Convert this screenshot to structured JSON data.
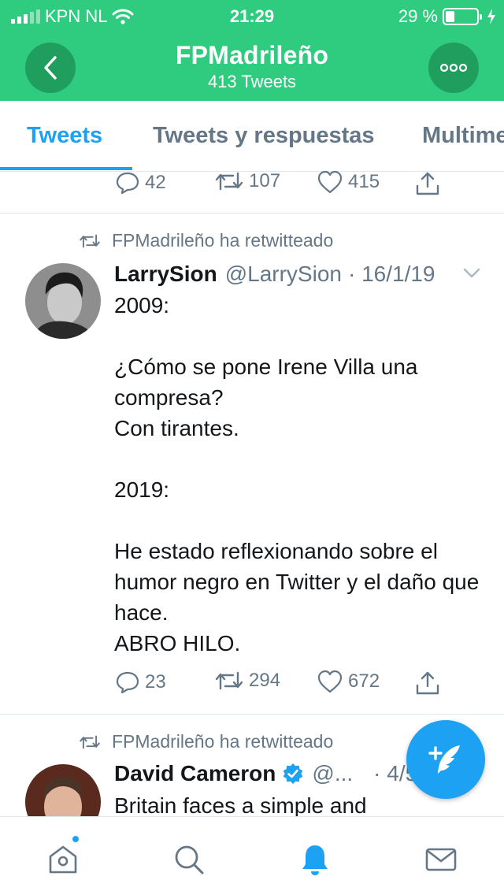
{
  "colors": {
    "header_green": "#2fcc7f",
    "header_button": "#209e5e",
    "twitter_blue": "#1da1f2",
    "muted_gray": "#657786"
  },
  "status_bar": {
    "carrier": "KPN NL",
    "time": "21:29",
    "battery_percent": "29 %",
    "battery_level": 0.29,
    "icons": [
      "signal-icon",
      "wifi-icon",
      "battery-icon",
      "charging-icon"
    ]
  },
  "header": {
    "title": "FPMadrileño",
    "subtitle": "413 Tweets",
    "back_icon": "chevron-left-icon",
    "more_icon": "more-options-icon"
  },
  "tabs": [
    {
      "label": "Tweets",
      "active": true
    },
    {
      "label": "Tweets y respuestas",
      "active": false
    },
    {
      "label": "Multime",
      "active": false
    }
  ],
  "previous_tweet_actions": {
    "replies": "42",
    "retweets": "107",
    "likes": "415"
  },
  "tweets": [
    {
      "retweeted_by": "FPMadrileño ha retwitteado",
      "display_name": "LarrySion",
      "handle": "@LarrySion",
      "date": "· 16/1/19",
      "text": "2009:\n\n¿Cómo se pone Irene Villa una compresa?\nCon tirantes.\n\n2019:\n\nHe estado reflexionando sobre el humor negro en Twitter y el daño que hace.\nABRO HILO.",
      "actions": {
        "replies": "23",
        "retweets": "294",
        "likes": "672"
      }
    },
    {
      "retweeted_by": "FPMadrileño ha retwitteado",
      "display_name": "David Cameron",
      "verified": true,
      "handle": "@...",
      "date": "· 4/5",
      "text": "Britain faces a simple and"
    }
  ],
  "compose_button": {
    "icon": "compose-tweet-icon"
  },
  "bottom_nav": [
    {
      "icon": "home-icon",
      "active": false,
      "has_notification_dot": true
    },
    {
      "icon": "search-icon",
      "active": false
    },
    {
      "icon": "notifications-bell-icon",
      "active": true
    },
    {
      "icon": "messages-envelope-icon",
      "active": false
    }
  ]
}
